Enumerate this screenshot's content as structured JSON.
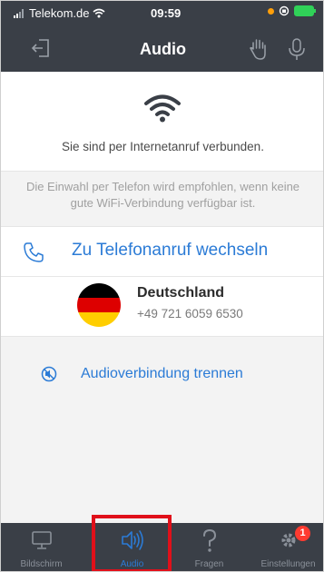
{
  "status_bar": {
    "carrier": "Telekom.de",
    "time": "09:59"
  },
  "nav": {
    "title": "Audio",
    "icons": [
      "exit-icon",
      "raise-hand-icon",
      "microphone-icon"
    ]
  },
  "connection": {
    "status_text": "Sie sind per Internetanruf verbunden.",
    "hint": "Die Einwahl per Telefon wird empfohlen, wenn keine gute WiFi-Verbindung verfügbar ist."
  },
  "phone": {
    "switch_label": "Zu Telefonanruf wechseln",
    "country": "Deutschland",
    "number": "+49 721 6059 6530"
  },
  "disconnect": {
    "label": "Audioverbindung trennen"
  },
  "tabs": [
    {
      "label": "Bildschirm",
      "icon": "monitor-icon",
      "active": false
    },
    {
      "label": "Audio",
      "icon": "speaker-icon",
      "active": true
    },
    {
      "label": "Fragen",
      "icon": "question-icon",
      "active": false
    },
    {
      "label": "Einstellungen",
      "icon": "gear-icon",
      "active": false,
      "badge": "1"
    }
  ],
  "colors": {
    "bar_background": "#3a3f47",
    "accent": "#2b7bd6",
    "highlight": "#e0101a",
    "badge": "#ff3b30"
  }
}
